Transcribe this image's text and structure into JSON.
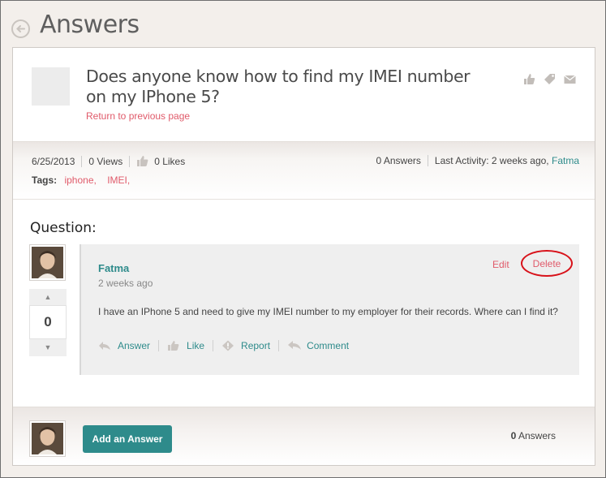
{
  "page": {
    "title": "Answers"
  },
  "question": {
    "title": "Does anyone know how to find my IMEI number on my IPhone 5?",
    "return_link": "Return to previous page",
    "date": "6/25/2013",
    "views": "0 Views",
    "likes": "0 Likes",
    "answers": "0 Answers",
    "last_activity_label": "Last Activity: 2 weeks ago,",
    "last_activity_user": "Fatma",
    "tags_label": "Tags:",
    "tags": [
      "iphone,",
      "IMEI,"
    ],
    "section_label": "Question:"
  },
  "icons": [
    "thumbs-up-icon",
    "tag-icon",
    "envelope-icon",
    "back-arrow-icon",
    "reply-icon",
    "like-icon",
    "report-icon",
    "comment-icon"
  ],
  "post": {
    "author": "Fatma",
    "time": "2 weeks ago",
    "edit_label": "Edit",
    "delete_label": "Delete",
    "body": "I have an IPhone 5 and need to give my IMEI number to my employer for their records. Where can I find it?",
    "vote_count": "0",
    "actions": {
      "answer": "Answer",
      "like": "Like",
      "report": "Report",
      "comment": "Comment"
    }
  },
  "footer": {
    "add_answer_label": "Add an Answer",
    "answer_count": "0",
    "answer_word": "Answers"
  },
  "colors": {
    "accent": "#2e8b8b",
    "link_red": "#e05a6a",
    "highlight_circle": "#d8121a"
  }
}
